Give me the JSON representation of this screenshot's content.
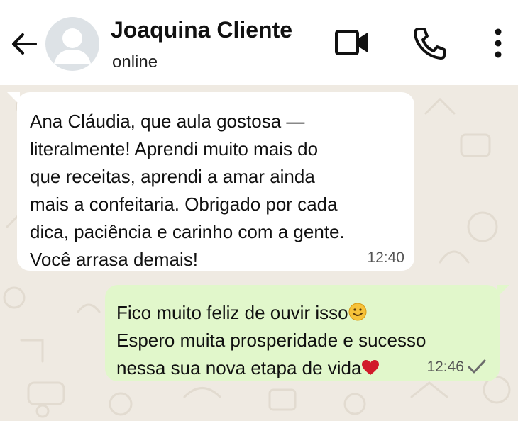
{
  "header": {
    "contact_name": "Joaquina Cliente",
    "status": "online",
    "icons": [
      "back-arrow-icon",
      "avatar-placeholder-icon",
      "video-call-icon",
      "phone-icon",
      "more-options-icon"
    ]
  },
  "messages": {
    "incoming": {
      "text": "Ana Cláudia, que aula gostosa —\nliteralmente! Aprendi muito mais do\nque receitas, aprendi a amar ainda\nmais a confeitaria. Obrigado por cada\ndica, paciência e carinho com a gente.\nVocê arrasa demais!",
      "time": "12:40"
    },
    "outgoing": {
      "line1": "Fico muito feliz de ouvir isso",
      "line2": "Espero muita prosperidade e sucesso",
      "line3": "nessa sua nova etapa de vida",
      "time": "12:46",
      "status_icon": "single-check-icon"
    }
  },
  "colors": {
    "chat_background": "#efeae2",
    "incoming_bubble": "#ffffff",
    "outgoing_bubble": "#e1f7cb",
    "heart": "#d11a2a",
    "smiley": "#f6c23a"
  }
}
